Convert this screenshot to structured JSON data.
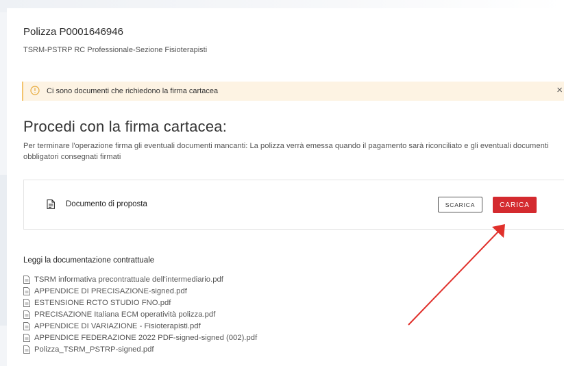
{
  "policy": {
    "title": "Polizza P0001646946",
    "subtitle": "TSRM-PSTRP RC Professionale-Sezione Fisioterapisti"
  },
  "alert": {
    "text": "Ci sono documenti che richiedono la firma cartacea",
    "close": "×",
    "color": "#f3c46e"
  },
  "section": {
    "heading": "Procedi con la firma cartacea:",
    "description": "Per terminare l'operazione firma gli eventuali documenti mancanti: La polizza verrà emessa quando il pagamento sarà riconciliato e gli eventuali documenti obbligatori consegnati firmati"
  },
  "document": {
    "name": "Documento di proposta",
    "download_label": "SCARICA",
    "upload_label": "CARICA",
    "accent_color": "#d42a2f"
  },
  "contract_docs": {
    "heading": "Leggi la documentazione contrattuale",
    "files": [
      "TSRM informativa precontrattuale dell'intermediario.pdf",
      "APPENDICE DI PRECISAZIONE-signed.pdf",
      "ESTENSIONE RCTO STUDIO FNO.pdf",
      "PRECISAZIONE Italiana ECM operatività polizza.pdf",
      "APPENDICE DI VARIAZIONE - Fisioterapisti.pdf",
      "APPENDICE FEDERAZIONE 2022 PDF-signed-signed (002).pdf",
      "Polizza_TSRM_PSTRP-signed.pdf"
    ]
  },
  "icons": {
    "alert": "info-circle-icon",
    "document": "document-icon",
    "file": "file-icon",
    "annotation": "red-arrow-annotation"
  }
}
